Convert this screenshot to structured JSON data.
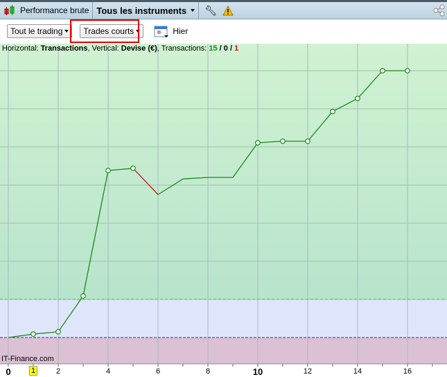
{
  "topbar": {
    "title": "Performance brute",
    "instruments": "Tous les instruments"
  },
  "toolbar": {
    "filter1": "Tout le trading",
    "filter2": "Trades courts",
    "date": "Hier"
  },
  "info": {
    "h_label": "Horizontal: ",
    "h_value": "Transactions",
    "v_label": ", Vertical: ",
    "v_value": "Devise (€)",
    "t_label": ", Transactions: ",
    "win": "15",
    "sep1": " / ",
    "neutral": "0",
    "sep2": " / ",
    "loss": "1"
  },
  "brand": "IT-Finance.com",
  "colors": {
    "gain": "#1a8a1a",
    "loss": "#c01818",
    "gain_zone": "#c6ecd0",
    "neutral_zone": "#dfe6fb",
    "loss_zone": "#dbc1d3"
  },
  "chart_data": {
    "type": "line",
    "xlabel": "Transactions",
    "ylabel": "Devise (€)",
    "x": [
      0,
      1,
      2,
      3,
      4,
      5,
      6,
      7,
      8,
      9,
      10,
      11,
      12,
      13,
      14,
      15,
      16
    ],
    "y": [
      0,
      0.09,
      0.15,
      1.09,
      4.38,
      4.44,
      3.75,
      4.16,
      4.2,
      4.2,
      5.11,
      5.15,
      5.15,
      5.93,
      6.27,
      7.0,
      7.0
    ],
    "markers": [
      false,
      true,
      true,
      true,
      true,
      true,
      false,
      false,
      false,
      false,
      true,
      true,
      true,
      true,
      true,
      true,
      true
    ],
    "losing_segments": [
      [
        5,
        6
      ]
    ],
    "threshold_line": 1.0,
    "xlim": [
      -0.33,
      17.6
    ],
    "ylim": [
      -0.69,
      7.7
    ],
    "x_ticks": [
      "0",
      "1",
      "2",
      "4",
      "6",
      "8",
      "10",
      "12",
      "14",
      "16"
    ],
    "highlighted_tick": "1"
  }
}
